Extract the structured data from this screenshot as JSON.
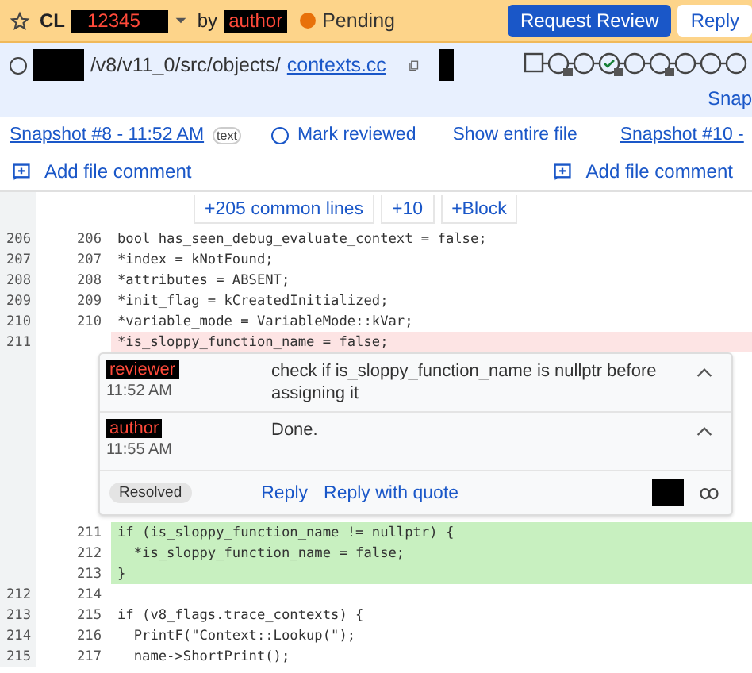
{
  "top_bar": {
    "starred": false,
    "cl_label": "CL",
    "cl_number": "12345",
    "by": "by",
    "author": "author",
    "status": "Pending",
    "buttons": [
      {
        "label": "Request Review",
        "kind": "primary"
      },
      {
        "label": "Reply",
        "kind": "secondary"
      }
    ]
  },
  "file_header": {
    "reviewed": false,
    "path_prefix": "/v8/v11_0/src/objects/",
    "file_name": "contexts.cc",
    "snapshot_link": "Snap"
  },
  "snapshot_row": {
    "left": "Snapshot #8 - 11:52 AM",
    "tag": "text",
    "reviewed": false,
    "mark_reviewed": "Mark reviewed",
    "show_entire": "Show entire file",
    "right": "Snapshot #10 -"
  },
  "file_comment_links": [
    "Add file comment",
    "Add file comment"
  ],
  "expand_buttons": [
    "+205 common lines",
    "+10",
    "+Block"
  ],
  "lines_before": [
    {
      "old": "206",
      "new": "206",
      "code": "bool has_seen_debug_evaluate_context = false;",
      "kind": "context"
    },
    {
      "old": "207",
      "new": "207",
      "code": "*index = kNotFound;",
      "kind": "context"
    },
    {
      "old": "208",
      "new": "208",
      "code": "*attributes = ABSENT;",
      "kind": "context"
    },
    {
      "old": "209",
      "new": "209",
      "code": "*init_flag = kCreatedInitialized;",
      "kind": "context"
    },
    {
      "old": "210",
      "new": "210",
      "code": "*variable_mode = VariableMode::kVar;",
      "kind": "context"
    },
    {
      "old": "211",
      "code": "*is_sloppy_function_name = false;",
      "kind": "removed"
    }
  ],
  "thread": {
    "comments": [
      {
        "author": "reviewer",
        "time": "11:52 AM",
        "text": "check if is_sloppy_function_name is nullptr before assigning it",
        "expanded": true
      },
      {
        "author": "author",
        "time": "11:55 AM",
        "text": "Done.",
        "expanded": true
      }
    ],
    "status": "Resolved",
    "actions": [
      "Reply",
      "Reply with quote"
    ]
  },
  "lines_after": [
    {
      "new": "211",
      "code": "if (is_sloppy_function_name != nullptr) {",
      "kind": "added"
    },
    {
      "new": "212",
      "code": "  *is_sloppy_function_name = false;",
      "kind": "added"
    },
    {
      "new": "213",
      "code": "}",
      "kind": "added"
    },
    {
      "old": "212",
      "new": "214",
      "kind": "context"
    },
    {
      "old": "213",
      "new": "215",
      "code": "if (v8_flags.trace_contexts) {",
      "kind": "context"
    },
    {
      "old": "214",
      "new": "216",
      "code": "  PrintF(\"Context::Lookup(\");",
      "kind": "context"
    },
    {
      "old": "215",
      "new": "217",
      "code": "  name->ShortPrint();",
      "kind": "context"
    }
  ]
}
